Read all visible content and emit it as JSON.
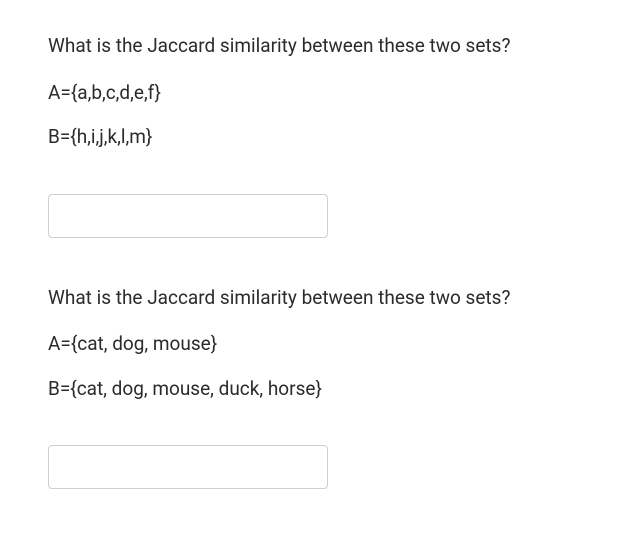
{
  "questions": [
    {
      "prompt": "What is the Jaccard similarity between these two sets?",
      "setA": "A={a,b,c,d,e,f}",
      "setB": "B={h,i,j,k,l,m}",
      "answer": ""
    },
    {
      "prompt": "What is the Jaccard similarity between these two sets?",
      "setA": "A={cat, dog, mouse}",
      "setB": "B={cat, dog, mouse, duck, horse}",
      "answer": ""
    }
  ]
}
